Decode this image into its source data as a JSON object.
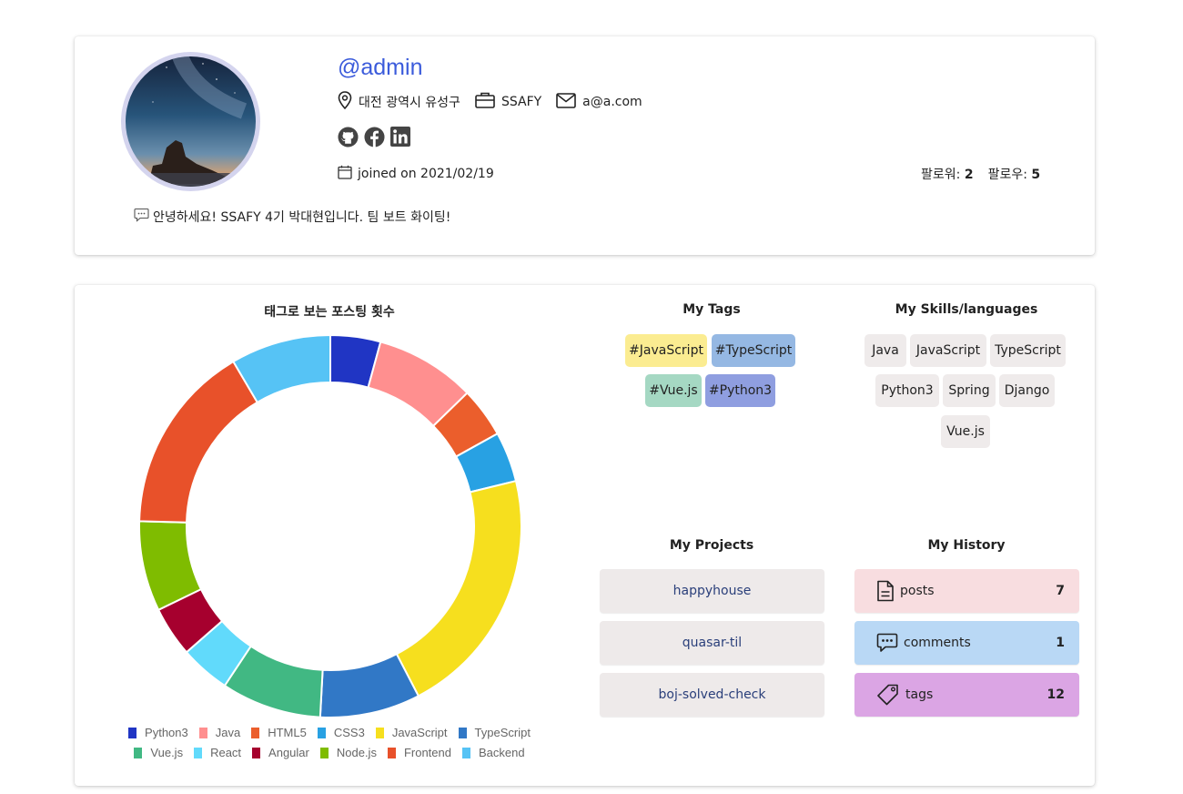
{
  "profile": {
    "username": "@admin",
    "location": "대전 광역시 유성구",
    "company": "SSAFY",
    "email": "a@a.com",
    "joined": "joined on 2021/02/19",
    "followers_label": "팔로워:",
    "followers_count": "2",
    "following_label": "팔로우:",
    "following_count": "5",
    "bio": "안녕하세요! SSAFY 4기 박대현입니다. 팀 보트 화이팅!"
  },
  "chart_section": {
    "title": "태그로 보는 포스팅 횟수"
  },
  "chart_data": {
    "type": "pie",
    "donut": true,
    "title": "태그로 보는 포스팅 횟수",
    "categories": [
      "Python3",
      "Java",
      "HTML5",
      "CSS3",
      "JavaScript",
      "TypeScript",
      "Vue.js",
      "React",
      "Angular",
      "Node.js",
      "Frontend",
      "Backend"
    ],
    "values": [
      5,
      10,
      5,
      5,
      25,
      10,
      10,
      5,
      5,
      9,
      19,
      10
    ],
    "colors": [
      "#2035c4",
      "#ff8f8f",
      "#eb5e2c",
      "#28a1e3",
      "#f6df1e",
      "#3178c6",
      "#41b883",
      "#61dafb",
      "#a6002e",
      "#7fbc00",
      "#e8512a",
      "#56c3f5"
    ],
    "legend_position": "bottom"
  },
  "tags": {
    "title": "My Tags",
    "items": [
      {
        "label": "#JavaScript",
        "color": "#fbec91"
      },
      {
        "label": "#TypeScript",
        "color": "#95b8e3"
      },
      {
        "label": "#Vue.js",
        "color": "#a5d8c3"
      },
      {
        "label": "#Python3",
        "color": "#8f9ee0"
      }
    ]
  },
  "skills": {
    "title": "My Skills/languages",
    "items": [
      "Java",
      "JavaScript",
      "TypeScript",
      "Python3",
      "Spring",
      "Django",
      "Vue.js"
    ]
  },
  "projects": {
    "title": "My Projects",
    "items": [
      "happyhouse",
      "quasar-til",
      "boj-solved-check"
    ]
  },
  "history": {
    "title": "My History",
    "items": [
      {
        "label": "posts",
        "count": "7",
        "icon": "document-icon",
        "color": "#f8dde0"
      },
      {
        "label": "comments",
        "count": "1",
        "icon": "chat-icon",
        "color": "#b9d8f5"
      },
      {
        "label": "tags",
        "count": "12",
        "icon": "tag-icon",
        "color": "#dba5e4"
      }
    ]
  }
}
